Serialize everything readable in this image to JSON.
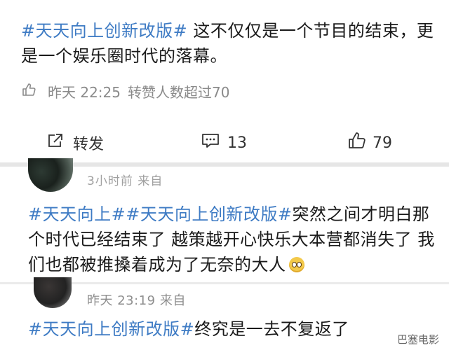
{
  "post1": {
    "hashtag": "#天天向上创新改版#",
    "text": " 这不仅仅是一个节目的结束，更是一个娱乐圈时代的落幕。",
    "time": "昨天 22:25",
    "likes_note": "转赞人数超过70"
  },
  "actions": {
    "repost_label": "转发",
    "comment_count": "13",
    "like_count": "79"
  },
  "comment1": {
    "meta": "3小时前  来自 ",
    "hashtag1": "#天天向上#",
    "hashtag2": "#天天向上创新改版#",
    "text": "突然之间才明白那个时代已经结束了 越策越开心快乐大本营都消失了 我们也都被推搡着成为了无奈的大人",
    "emoji": "pleading-face-emoji"
  },
  "comment2": {
    "meta": "昨天 23:19  来自",
    "hashtag": "#天天向上创新改版#",
    "text": "终究是一去不复返了"
  },
  "watermark": "巴塞电影",
  "colors": {
    "hashtag": "#3e7bc4",
    "meta": "#8a8a8a",
    "separator": "#e6e6e6"
  }
}
